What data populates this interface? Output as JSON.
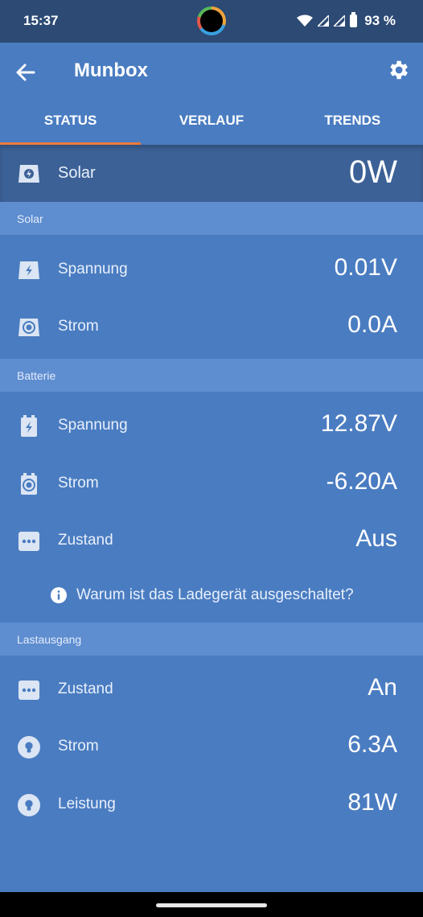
{
  "statusbar": {
    "time": "15:37",
    "battery_text": "93 %",
    "icons": [
      "wifi-icon",
      "signal-icon",
      "signal-icon",
      "battery-icon"
    ]
  },
  "header": {
    "title": "Munbox",
    "back_icon": "arrow-left-icon",
    "settings_icon": "gear-icon"
  },
  "tabs": [
    {
      "label": "STATUS",
      "active": true
    },
    {
      "label": "VERLAUF",
      "active": false
    },
    {
      "label": "TRENDS",
      "active": false
    }
  ],
  "summary": {
    "label": "Solar",
    "value": "0W",
    "icon": "solar-panel-bolt-icon"
  },
  "sections": {
    "solar": {
      "title": "Solar",
      "rows": [
        {
          "label": "Spannung",
          "value": "0.01V",
          "icon": "solar-voltage-icon"
        },
        {
          "label": "Strom",
          "value": "0.0A",
          "icon": "solar-current-icon"
        }
      ]
    },
    "batterie": {
      "title": "Batterie",
      "rows": [
        {
          "label": "Spannung",
          "value": "12.87V",
          "icon": "battery-voltage-icon"
        },
        {
          "label": "Strom",
          "value": "-6.20A",
          "icon": "battery-current-icon"
        },
        {
          "label": "Zustand",
          "value": "Aus",
          "icon": "state-dots-icon"
        }
      ],
      "info": "Warum ist das Ladegerät ausgeschaltet?"
    },
    "lastausgang": {
      "title": "Lastausgang",
      "rows": [
        {
          "label": "Zustand",
          "value": "An",
          "icon": "state-dots-icon"
        },
        {
          "label": "Strom",
          "value": "6.3A",
          "icon": "lightbulb-icon"
        },
        {
          "label": "Leistung",
          "value": "81W",
          "icon": "lightbulb-icon"
        }
      ]
    }
  },
  "colors": {
    "background": "#4a7cc1",
    "statusbar": "#2c4a73",
    "summary": "#3c6196",
    "section_header": "#5e8dd0",
    "tab_indicator": "#f07a3a"
  }
}
